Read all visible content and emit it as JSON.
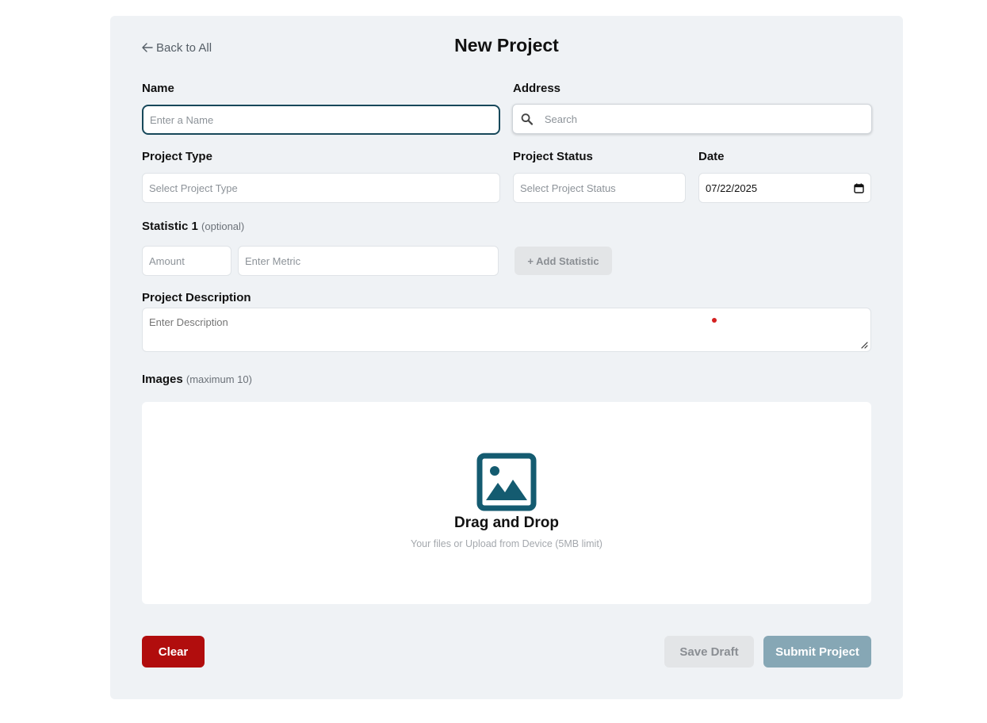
{
  "header": {
    "back_label": "Back to All",
    "title": "New Project"
  },
  "form": {
    "name": {
      "label": "Name",
      "placeholder": "Enter a Name",
      "value": ""
    },
    "address": {
      "label": "Address",
      "placeholder": "Search",
      "value": ""
    },
    "project_type": {
      "label": "Project Type",
      "placeholder": "Select Project Type"
    },
    "project_status": {
      "label": "Project Status",
      "placeholder": "Select Project Status"
    },
    "date": {
      "label": "Date",
      "value": "07/22/2025"
    },
    "statistic": {
      "label": "Statistic 1",
      "optional_note": "(optional)",
      "amount_placeholder": "Amount",
      "metric_placeholder": "Enter Metric",
      "add_label": "+ Add Statistic"
    },
    "description": {
      "label": "Project Description",
      "placeholder": "Enter Description"
    },
    "images": {
      "label": "Images",
      "limit_note": "(maximum 10)",
      "drop_title": "Drag and Drop",
      "drop_subtitle": "Your files or Upload from Device (5MB limit)"
    }
  },
  "actions": {
    "clear_label": "Clear",
    "save_draft_label": "Save Draft",
    "submit_label": "Submit Project"
  },
  "colors": {
    "card_bg": "#eff2f5",
    "accent": "#17485a",
    "icon_teal": "#145b70",
    "danger": "#b10d0d",
    "submit_disabled": "#86a7b5"
  }
}
